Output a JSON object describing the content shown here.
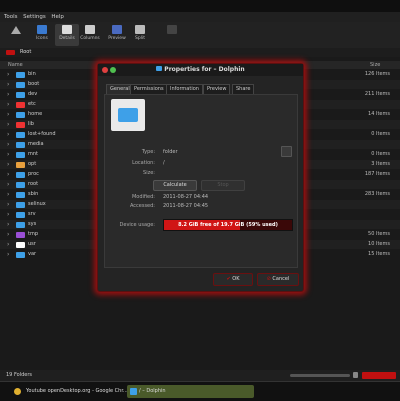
{
  "menubar": [
    "Tools",
    "Settings",
    "Help"
  ],
  "toolbar": {
    "items": [
      "Icons",
      "Details",
      "Columns",
      "Preview",
      "Split"
    ]
  },
  "location": {
    "root_label": "Root"
  },
  "columns": {
    "name": "Name",
    "size": "Size"
  },
  "files": [
    {
      "name": "bin",
      "size": "126 Items",
      "color": "#3ea0e8"
    },
    {
      "name": "boot",
      "size": "",
      "color": "#3ea0e8"
    },
    {
      "name": "dev",
      "size": "211 Items",
      "color": "#3ea0e8"
    },
    {
      "name": "etc",
      "size": "",
      "color": "#e33"
    },
    {
      "name": "home",
      "size": "14 Items",
      "color": "#3ea0e8"
    },
    {
      "name": "lib",
      "size": "",
      "color": "#e33"
    },
    {
      "name": "lost+found",
      "size": "0 Items",
      "color": "#3ea0e8"
    },
    {
      "name": "media",
      "size": "",
      "color": "#3ea0e8"
    },
    {
      "name": "mnt",
      "size": "0 Items",
      "color": "#3ea0e8"
    },
    {
      "name": "opt",
      "size": "3 Items",
      "color": "#e8a03e"
    },
    {
      "name": "proc",
      "size": "187 Items",
      "color": "#3ea0e8"
    },
    {
      "name": "root",
      "size": "",
      "color": "#3ea0e8"
    },
    {
      "name": "sbin",
      "size": "283 Items",
      "color": "#3ea0e8"
    },
    {
      "name": "selinux",
      "size": "",
      "color": "#3ea0e8"
    },
    {
      "name": "srv",
      "size": "",
      "color": "#3ea0e8"
    },
    {
      "name": "sys",
      "size": "",
      "color": "#3ea0e8"
    },
    {
      "name": "tmp",
      "size": "50 Items",
      "color": "#9a4fd6"
    },
    {
      "name": "usr",
      "size": "10 Items",
      "color": "#ffffff"
    },
    {
      "name": "var",
      "size": "15 Items",
      "color": "#3ea0e8"
    }
  ],
  "status": {
    "text": "19 Folders"
  },
  "taskbar": {
    "task1": "Youtube openDesktop.org - Google Chr...",
    "task2": "/ – Dolphin"
  },
  "dialog": {
    "title": "Properties for  – Dolphin",
    "tabs": [
      "General",
      "Permissions",
      "Information",
      "Preview",
      "Share"
    ],
    "type_label": "Type:",
    "type_value": "folder",
    "location_label": "Location:",
    "location_value": "/",
    "size_label": "Size:",
    "calculate_label": "Calculate",
    "stop_label": "Stop",
    "modified_label": "Modified:",
    "modified_value": "2011-08-27 04:44",
    "accessed_label": "Accessed:",
    "accessed_value": "2011-08-27 04:45",
    "device_usage_label": "Device usage:",
    "usage_text": "8.2 GiB free of 19.7 GiB (59% used)",
    "usage_fraction": 0.59,
    "ok_label": "OK",
    "cancel_label": "Cancel"
  },
  "colors": {
    "accent": "#c01010",
    "folder": "#3ea0e8"
  }
}
